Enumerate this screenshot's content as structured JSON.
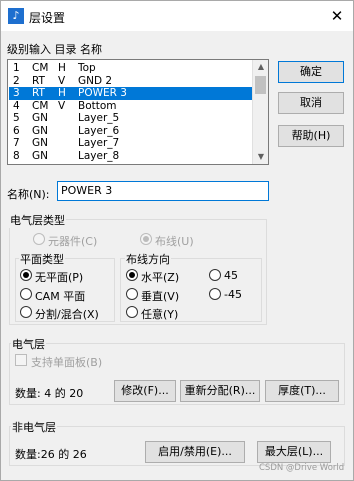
{
  "window": {
    "title": "层设置",
    "app_icon": "layer-app-icon",
    "close_glyph": "✕"
  },
  "list": {
    "header": "级别输入 目录 名称",
    "rows": [
      {
        "num": "1",
        "type": "CM",
        "flag": "H",
        "name": "Top"
      },
      {
        "num": "2",
        "type": "RT",
        "flag": "V",
        "name": "GND 2"
      },
      {
        "num": "3",
        "type": "RT",
        "flag": "H",
        "name": "POWER 3"
      },
      {
        "num": "4",
        "type": "CM",
        "flag": "V",
        "name": "Bottom"
      },
      {
        "num": "5",
        "type": "GN",
        "flag": "",
        "name": "Layer_5"
      },
      {
        "num": "6",
        "type": "GN",
        "flag": "",
        "name": "Layer_6"
      },
      {
        "num": "7",
        "type": "GN",
        "flag": "",
        "name": "Layer_7"
      },
      {
        "num": "8",
        "type": "GN",
        "flag": "",
        "name": "Layer_8"
      }
    ],
    "selected_index": 2
  },
  "buttons": {
    "ok": "确定",
    "cancel": "取消",
    "help": "帮助(H)",
    "modify": "修改(F)...",
    "reassign": "重新分配(R)...",
    "thickness": "厚度(T)...",
    "enable_disable": "启用/禁用(E)...",
    "max_layers": "最大层(L)..."
  },
  "name_field": {
    "label": "名称(N):",
    "value": "POWER 3"
  },
  "electrical_layer_type": {
    "title": "电气层类型",
    "component": "元器件(C)",
    "routing": "布线(U)",
    "plane_type": {
      "title": "平面类型",
      "options": [
        "无平面(P)",
        "CAM 平面",
        "分割/混合(X)"
      ],
      "selected": 0
    },
    "routing_direction": {
      "title": "布线方向",
      "options": [
        "水平(Z)",
        "垂直(V)",
        "任意(Y)",
        "45",
        "-45"
      ],
      "selected": 0
    }
  },
  "electrical_layers": {
    "title": "电气层",
    "single_sided": "支持单面板(B)",
    "count": "数量: 4 的 20"
  },
  "non_electrical_layers": {
    "title": "非电气层",
    "count": "数量:26 的 26"
  },
  "watermark": "CSDN @Drive World",
  "colors": {
    "selection": "#0078d7",
    "dialog_bg": "#f0f0f0"
  }
}
